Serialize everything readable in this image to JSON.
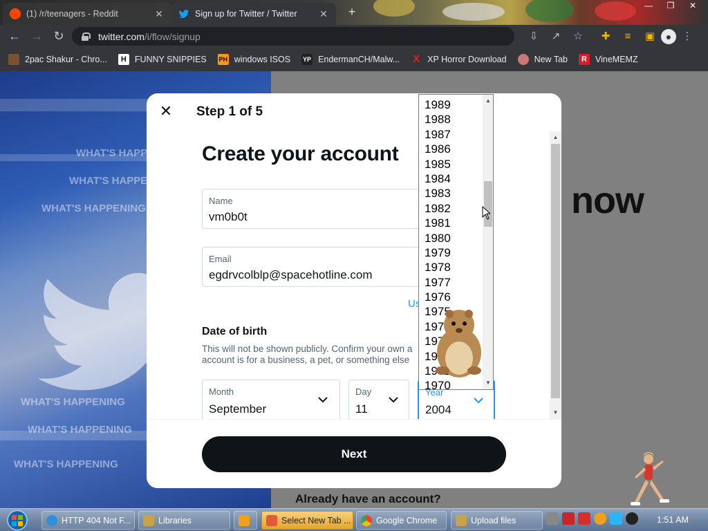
{
  "browser": {
    "tabs": [
      {
        "title": "(1) /r/teenagers - Reddit",
        "active": false
      },
      {
        "title": "Sign up for Twitter / Twitter",
        "active": true
      }
    ],
    "url_host": "twitter.com",
    "url_path": "/i/flow/signup",
    "bookmarks": [
      {
        "label": "2pac Shakur - Chro...",
        "icon": "2pac-icon"
      },
      {
        "label": "FUNNY SNIPPIES",
        "icon": "H",
        "color": "#111111"
      },
      {
        "label": "windows ISOS",
        "icon": "PH",
        "color": "#f7971d"
      },
      {
        "label": "EndermanCH/Malw...",
        "icon": "YP",
        "color": "#222222"
      },
      {
        "label": "XP Horror Download",
        "icon": "X",
        "color": "#e02020"
      },
      {
        "label": "New Tab",
        "icon": "new-tab-icon"
      },
      {
        "label": "VineMEMZ",
        "icon": "R",
        "color": "#d81e26"
      }
    ]
  },
  "background": {
    "headline_fragment": "now",
    "already_prompt": "Already have an account?",
    "banner_text": "WHAT'S HAPPENING"
  },
  "modal": {
    "step": "Step 1 of 5",
    "title": "Create your account",
    "name_label": "Name",
    "name_value": "vm0b0t",
    "email_label": "Email",
    "email_value": "egdrvcolblp@spacehotline.com",
    "use_phone_fragment": "Us",
    "dob_heading": "Date of birth",
    "dob_text": "This will not be shown publicly. Confirm your own a account is for a business, a pet, or something else",
    "month_label": "Month",
    "month_value": "September",
    "day_label": "Day",
    "day_value": "11",
    "year_label": "Year",
    "year_value": "2004",
    "next_label": "Next",
    "accent": "#1d9bf0"
  },
  "year_dropdown": {
    "items": [
      "1989",
      "1988",
      "1987",
      "1986",
      "1985",
      "1984",
      "1983",
      "1982",
      "1981",
      "1980",
      "1979",
      "1978",
      "1977",
      "1976",
      "1975",
      "1974",
      "1973",
      "1972",
      "1971",
      "1970"
    ]
  },
  "taskbar": {
    "items": [
      {
        "label": "HTTP 404 Not F...",
        "icon": "ie-icon",
        "active": false
      },
      {
        "label": "Libraries",
        "icon": "explorer-icon",
        "active": false
      },
      {
        "label": "",
        "icon": "media-player-icon",
        "active": false
      },
      {
        "label": "Select New Tab ...",
        "icon": "paint-icon",
        "active": true
      },
      {
        "label": "Google Chrome",
        "icon": "chrome-icon",
        "active": false
      },
      {
        "label": "Upload files",
        "icon": "upload-icon",
        "active": false
      }
    ],
    "clock": "1:51 AM"
  }
}
